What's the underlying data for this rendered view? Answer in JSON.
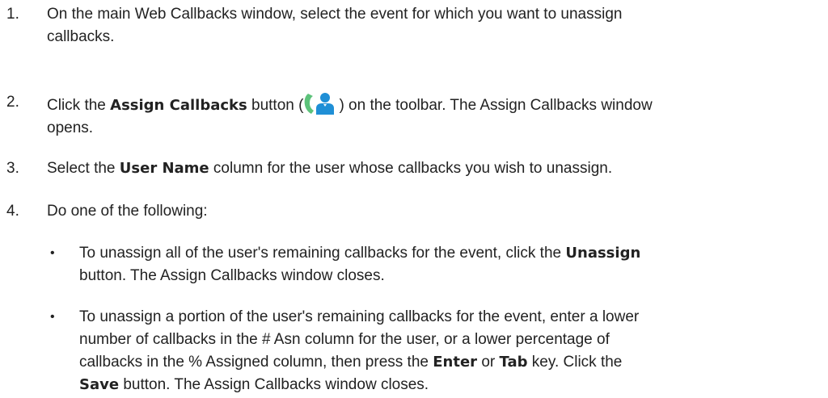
{
  "steps": [
    {
      "num": "1.",
      "line1": "On the main Web Callbacks window, select the event for which you want to unassign",
      "line2": "callbacks."
    },
    {
      "num": "2.",
      "pre": "Click the ",
      "bold": "Assign Callbacks",
      "mid": " button (",
      "icon": "assign-callbacks-icon",
      "post": ") on the toolbar. The Assign Callbacks window",
      "line2": "opens."
    },
    {
      "num": "3.",
      "pre": "Select the ",
      "bold": "User Name",
      "post": " column for the user whose callbacks you wish to unassign."
    },
    {
      "num": "4.",
      "text": "Do one of the following:"
    }
  ],
  "bullets": [
    {
      "symbol": "•",
      "l1_pre": "To unassign all of the user's remaining callbacks for the event, click the ",
      "l1_bold": "Unassign",
      "l2": "button. The Assign Callbacks window closes."
    },
    {
      "symbol": "•",
      "l1": "To unassign a portion of the user's remaining callbacks for the event, enter a lower",
      "l2": "number of callbacks in the # Asn column for the user, or a lower percentage of",
      "l3_pre": "callbacks in the % Assigned column, then press the ",
      "l3_bold1": "Enter",
      "l3_mid": " or ",
      "l3_bold2": "Tab",
      "l3_post": " key. Click the",
      "l4_bold": "Save",
      "l4_post": " button. The Assign Callbacks window closes."
    }
  ],
  "colors": {
    "text": "#222222",
    "icon_phone": "#5cc27a",
    "icon_user": "#1f8fd6"
  }
}
